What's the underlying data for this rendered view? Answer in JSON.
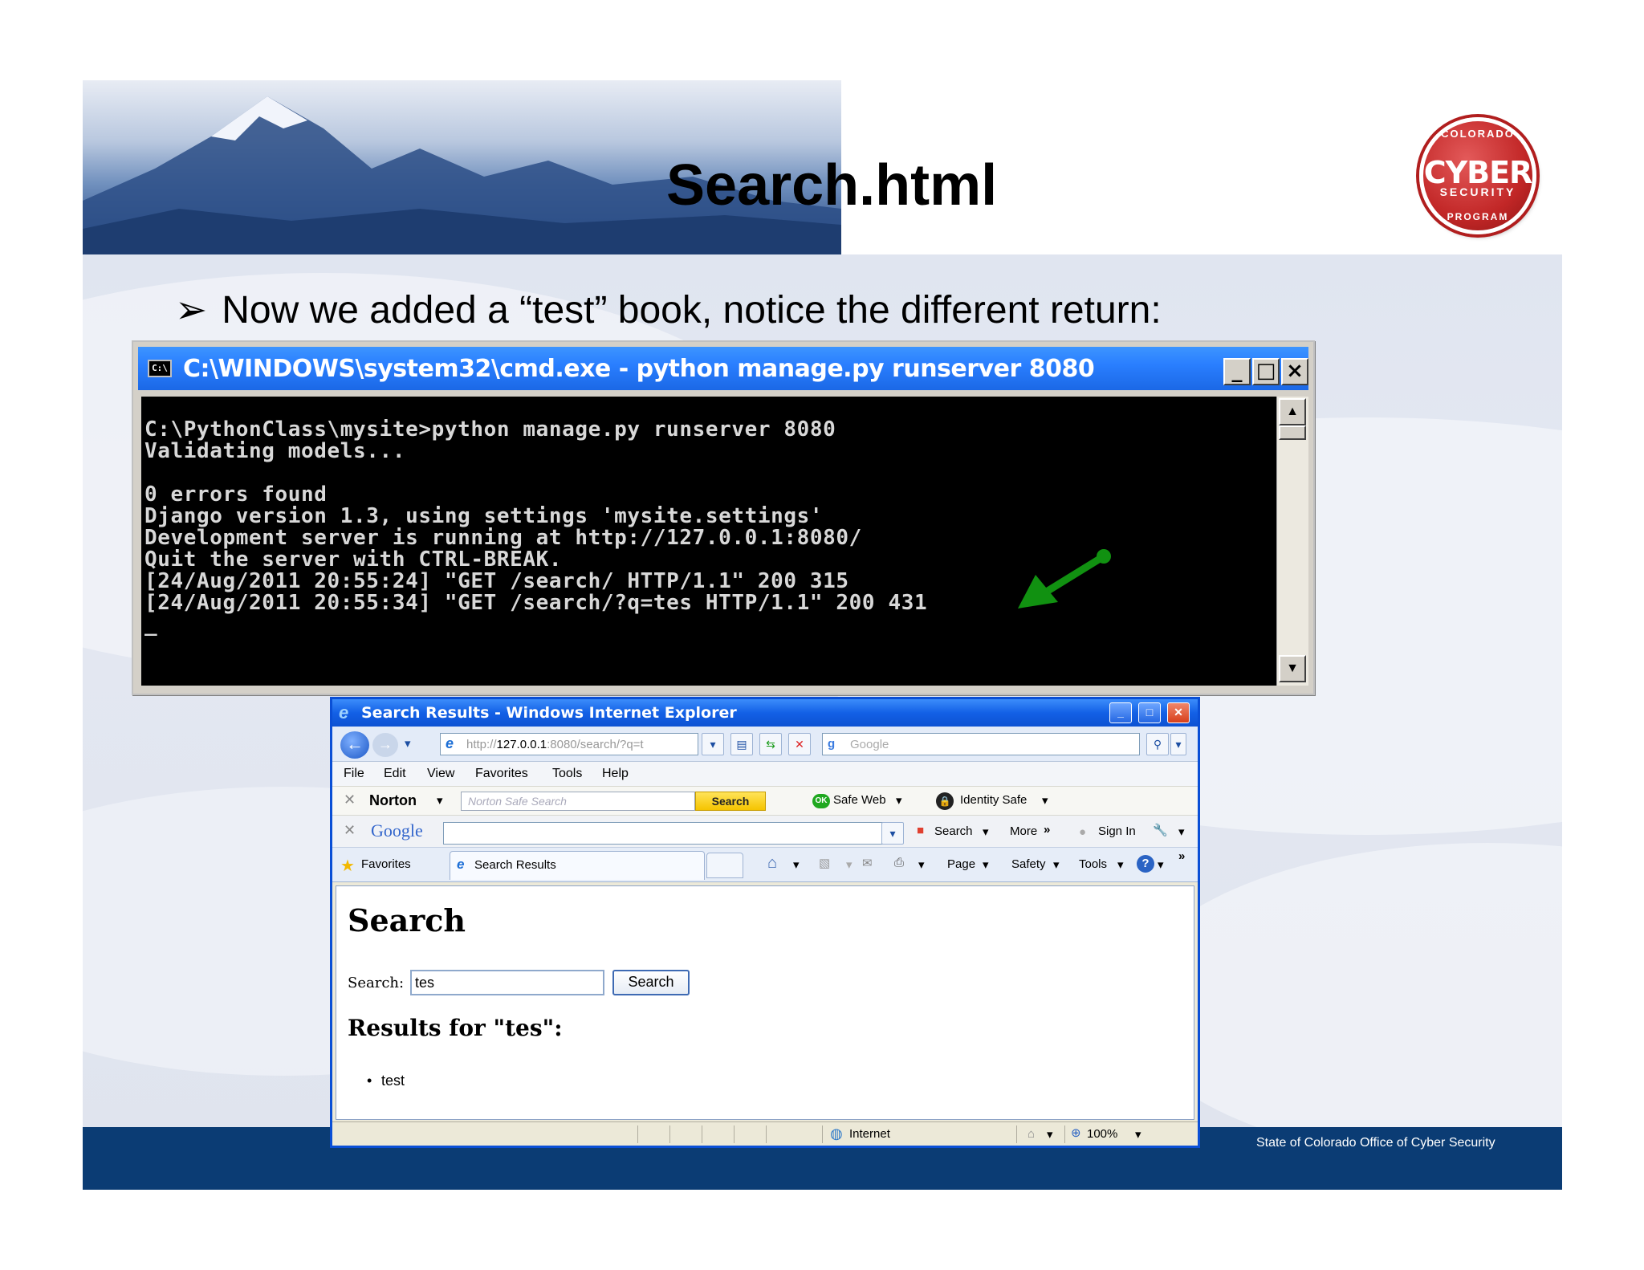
{
  "slide": {
    "title": "Search.html",
    "bullet": "Now we added a “test” book, notice the different return:",
    "bullet_marker": "➢",
    "footer": "State of Colorado Office of Cyber Security",
    "logo": {
      "top": "COLORADO",
      "main": "CYBER",
      "sub": "SECURITY",
      "bottom": "PROGRAM"
    }
  },
  "cmd": {
    "icon_label": "C:\\",
    "title": "C:\\WINDOWS\\system32\\cmd.exe - python manage.py runserver 8080",
    "lines": [
      "C:\\PythonClass\\mysite>python manage.py runserver 8080",
      "Validating models...",
      "",
      "0 errors found",
      "Django version 1.3, using settings 'mysite.settings'",
      "Development server is running at http://127.0.0.1:8080/",
      "Quit the server with CTRL-BREAK.",
      "[24/Aug/2011 20:55:24] \"GET /search/ HTTP/1.1\" 200 315",
      "[24/Aug/2011 20:55:34] \"GET /search/?q=tes HTTP/1.1\" 200 431",
      "_"
    ],
    "buttons": {
      "minimize": "_",
      "maximize": "□",
      "close": "×"
    },
    "arrow_color": "#119111"
  },
  "ie": {
    "title": "Search Results - Windows Internet Explorer",
    "address": {
      "prefix": "http://",
      "host": "127.0.0.1",
      "rest": ":8080/search/?q=t"
    },
    "google_box_placeholder": "Google",
    "menu": [
      "File",
      "Edit",
      "View",
      "Favorites",
      "Tools",
      "Help"
    ],
    "norton": {
      "brand": "Norton",
      "placeholder": "Norton Safe Search",
      "search_button": "Search",
      "safe_web": "Safe Web",
      "safe_web_badge": "OK",
      "identity_safe": "Identity Safe"
    },
    "google_bar": {
      "brand": "Google",
      "search": "Search",
      "more": "More",
      "sign_in": "Sign In"
    },
    "favorites_bar": {
      "favorites": "Favorites",
      "tab": "Search Results",
      "page": "Page",
      "safety": "Safety",
      "tools": "Tools"
    },
    "content": {
      "heading": "Search",
      "label": "Search:",
      "input_value": "tes",
      "button": "Search",
      "results_heading": "Results for \"tes\":",
      "results": [
        "test"
      ]
    },
    "status": {
      "zone": "Internet",
      "zoom": "100%"
    }
  }
}
